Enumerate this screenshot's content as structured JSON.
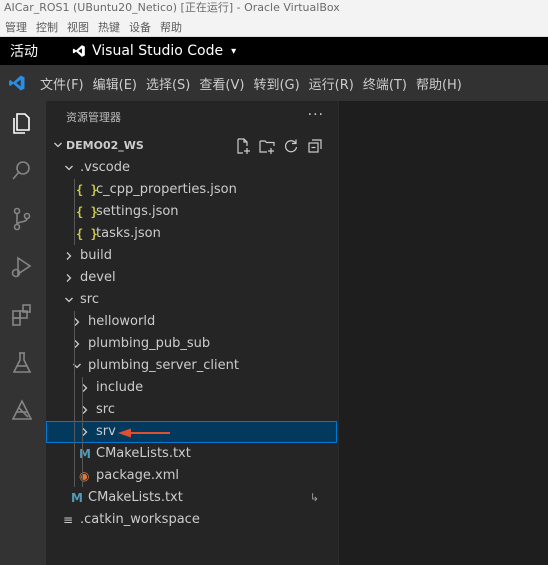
{
  "vbox": {
    "title": "AICar_ROS1 (UBuntu20_Netico) [正在运行] - Oracle VirtualBox",
    "menu": [
      "管理",
      "控制",
      "视图",
      "热键",
      "设备",
      "帮助"
    ]
  },
  "gnome": {
    "activities": "活动",
    "app_name": "Visual Studio Code",
    "app_caret": "▾"
  },
  "vscode_menu": [
    "文件(F)",
    "编辑(E)",
    "选择(S)",
    "查看(V)",
    "转到(G)",
    "运行(R)",
    "终端(T)",
    "帮助(H)"
  ],
  "activity_bar": [
    "explorer-icon",
    "search-icon",
    "source-control-icon",
    "run-debug-icon",
    "extensions-icon",
    "testing-icon",
    "ros-icon"
  ],
  "sidebar": {
    "title": "资源管理器",
    "more": "···",
    "workspace": "DEMO02_WS",
    "actions": [
      "new-file-icon",
      "new-folder-icon",
      "refresh-icon",
      "collapse-all-icon"
    ]
  },
  "tree": [
    {
      "label": ".vscode",
      "kind": "folder",
      "open": true,
      "depth": 1
    },
    {
      "label": "c_cpp_properties.json",
      "kind": "json",
      "icon": "{ }",
      "depth": 2
    },
    {
      "label": "settings.json",
      "kind": "json",
      "icon": "{ }",
      "depth": 2
    },
    {
      "label": "tasks.json",
      "kind": "json",
      "icon": "{ }",
      "depth": 2
    },
    {
      "label": "build",
      "kind": "folder",
      "open": false,
      "depth": 1
    },
    {
      "label": "devel",
      "kind": "folder",
      "open": false,
      "depth": 1
    },
    {
      "label": "src",
      "kind": "folder",
      "open": true,
      "depth": 1
    },
    {
      "label": "helloworld",
      "kind": "folder",
      "open": false,
      "depth": 2
    },
    {
      "label": "plumbing_pub_sub",
      "kind": "folder",
      "open": false,
      "depth": 2
    },
    {
      "label": "plumbing_server_client",
      "kind": "folder",
      "open": true,
      "depth": 2
    },
    {
      "label": "include",
      "kind": "folder",
      "open": false,
      "depth": 3
    },
    {
      "label": "src",
      "kind": "folder",
      "open": false,
      "depth": 3
    },
    {
      "label": "srv",
      "kind": "folder",
      "open": false,
      "depth": 3,
      "selected": true
    },
    {
      "label": "CMakeLists.txt",
      "kind": "cmake",
      "icon": "M",
      "depth": 3
    },
    {
      "label": "package.xml",
      "kind": "xml",
      "icon": "◉",
      "depth": 3
    },
    {
      "label": "CMakeLists.txt",
      "kind": "cmake",
      "icon": "M",
      "depth": 2,
      "shortcut": "↳"
    },
    {
      "label": ".catkin_workspace",
      "kind": "text",
      "icon": "≡",
      "depth": 1
    }
  ],
  "colors": {
    "selection_bg": "#04395e",
    "selection_border": "#0078d4",
    "arrow": "#e05030",
    "json_icon": "#cbcb41",
    "cmake_icon": "#519aba",
    "xml_icon": "#e37933"
  }
}
